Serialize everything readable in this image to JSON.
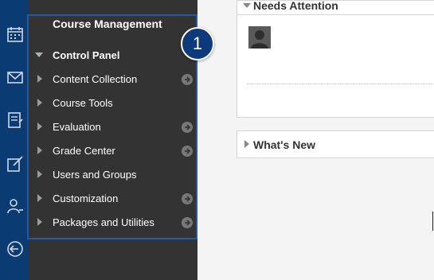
{
  "rail": {
    "icons": [
      "calendar-icon",
      "mail-icon",
      "grades-icon",
      "edit-icon",
      "people-icon",
      "logout-icon"
    ]
  },
  "course_menu": {
    "title": "Course Management",
    "control_panel_label": "Control Panel",
    "items": [
      {
        "label": "Content Collection",
        "has_arrow": true
      },
      {
        "label": "Course Tools",
        "has_arrow": false
      },
      {
        "label": "Evaluation",
        "has_arrow": true
      },
      {
        "label": "Grade Center",
        "has_arrow": true
      },
      {
        "label": "Users and Groups",
        "has_arrow": false
      },
      {
        "label": "Customization",
        "has_arrow": true
      },
      {
        "label": "Packages and Utilities",
        "has_arrow": true
      }
    ]
  },
  "badge": {
    "number": "1"
  },
  "modules": {
    "needs_attention": {
      "title": "Needs Attention"
    },
    "whats_new": {
      "title": "What's New"
    }
  },
  "colors": {
    "rail": "#0b3b73",
    "panel": "#333333",
    "highlight": "#1e5aa8",
    "badge": "#0c3a7a"
  }
}
